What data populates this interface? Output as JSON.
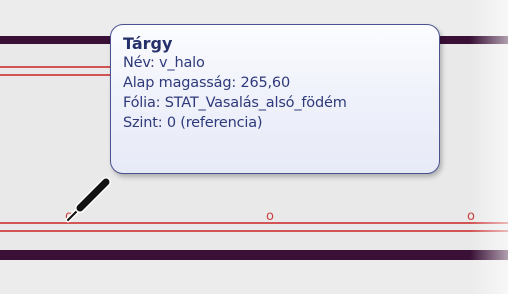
{
  "tooltip": {
    "title": "Tárgy",
    "lines": [
      "Név: v_halo",
      "Alap magasság: 265,60",
      "Fólia: STAT_Vasalás_alsó_födém",
      "Szint: 0 (referencia)"
    ]
  },
  "canvas": {
    "markers": [
      "o",
      "o",
      "o"
    ]
  },
  "colors": {
    "background": "#eaeaea",
    "wall_band": "#3a1036",
    "line_red": "#d25454",
    "tooltip_border": "#4a5390",
    "tooltip_text": "#2e3a7a"
  }
}
